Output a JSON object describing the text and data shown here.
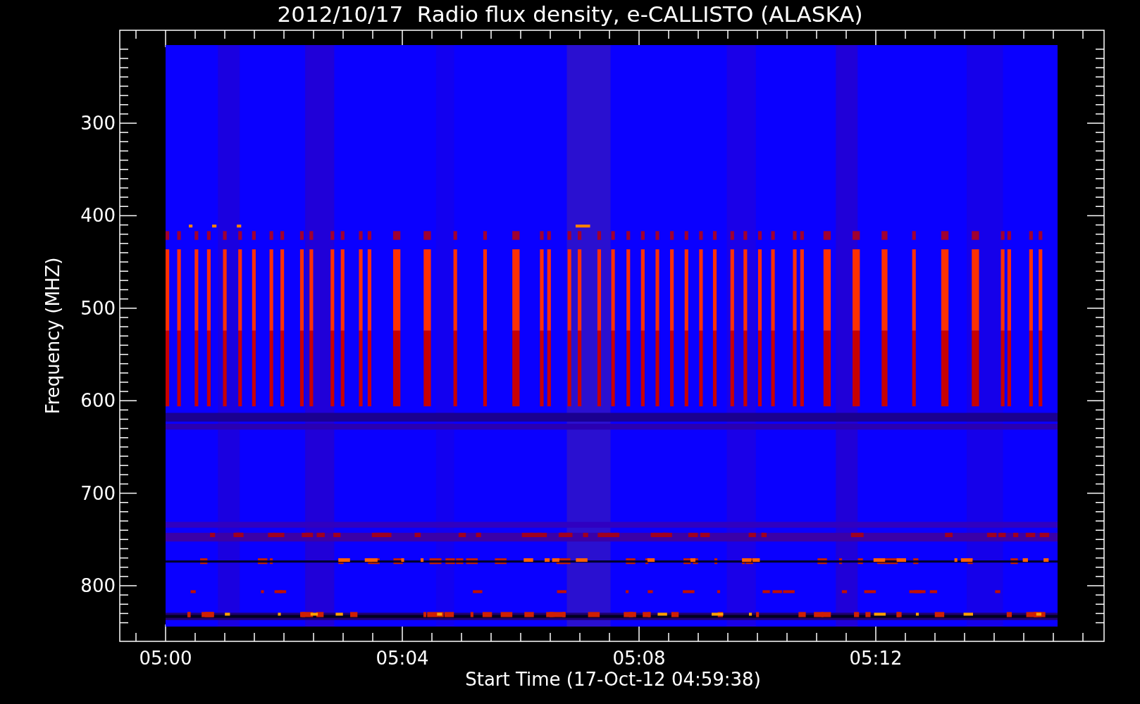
{
  "title": "2012/10/17  Radio flux density, e-CALLISTO (ALASKA)",
  "y_axis": {
    "label": "Frequency (MHZ)",
    "ticks": [
      "300",
      "400",
      "500",
      "600",
      "700",
      "800"
    ]
  },
  "x_axis": {
    "label": "Start Time (17-Oct-12 04:59:38)",
    "ticks": [
      "05:00",
      "05:04",
      "05:08",
      "05:12"
    ]
  }
}
